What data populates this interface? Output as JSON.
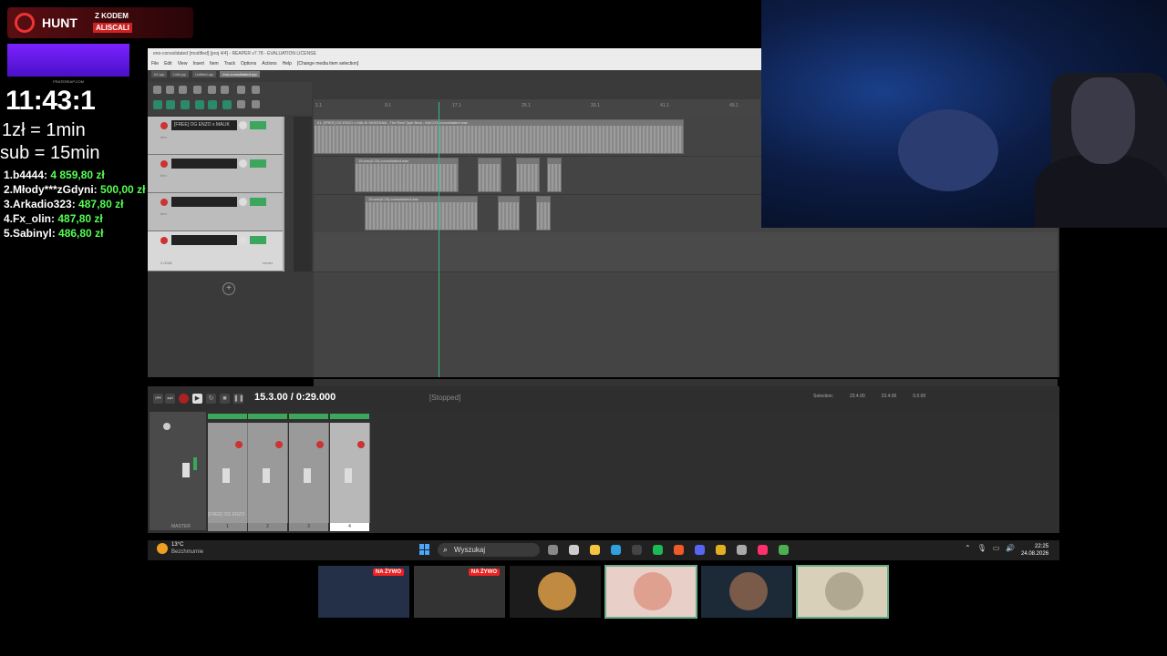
{
  "overlay": {
    "promo_brand": "HUNT",
    "promo_line1": "Z KODEM",
    "promo_code": "ALISCALI",
    "purple_caption": "PRATEREAP.COM",
    "timer": "11:43:1",
    "timer_digits": "43",
    "rate_line1": "1zł = 1min",
    "rate_line2": "sub = 15min",
    "leaderboard": [
      {
        "rank_name": "1.b4444:",
        "amount": "4 859,80 zł"
      },
      {
        "rank_name": "2.Młody***zGdyni:",
        "amount": "500,00 zł"
      },
      {
        "rank_name": "3.Arkadio323:",
        "amount": "487,80 zł"
      },
      {
        "rank_name": "4.Fx_olin:",
        "amount": "487,80 zł"
      },
      {
        "rank_name": "5.Sabinyl:",
        "amount": "486,80 zł"
      }
    ]
  },
  "reaper": {
    "title": "eno-consolidated [modified] [proj 4/4] - REAPER v7.78 - EVALUATION LICENSE",
    "menu": [
      "File",
      "Edit",
      "View",
      "Insert",
      "Item",
      "Track",
      "Options",
      "Actions",
      "Help",
      "[Change media item selection]"
    ],
    "tabs": [
      "h2.rpp",
      "h4d.rpp",
      "Untitled.rpp",
      "eno-consolidated.rpp"
    ],
    "ruler_ticks": [
      "1.1",
      "9.1",
      "17.1",
      "25.1",
      "33.1",
      "41.1",
      "49.1"
    ],
    "tracks": [
      {
        "name": "[FREE] OG ENZO x MALIK",
        "sub": "trim"
      },
      {
        "name": "",
        "sub": "trim"
      },
      {
        "name": "",
        "sub": "trim"
      },
      {
        "name": "",
        "sub": "0.00dB",
        "extra": "center"
      }
    ],
    "clips": [
      {
        "label": "01. [FREE] OG ENZO x MALIK MONTANA - The Real Type Beat - MACOS-consolidated.wav",
        "seg": "OFFLINE"
      },
      {
        "label": "15.wav(0.25)-consolidated.wav",
        "seg": "OFFLINE"
      },
      {
        "label": "15.wav(0.25)-consolidated.wav",
        "seg": "OFFLINE"
      }
    ],
    "transport_time": "15.3.00 / 0:29.000",
    "transport_state": "[Stopped]",
    "selection": [
      "Selection:",
      "23.4.00",
      "23.4.00",
      "0.0.00"
    ],
    "mixer_track_name": "[FREE] OG ENZO",
    "master_label": "MASTER",
    "mixer_nums": [
      "1",
      "2",
      "3",
      "4"
    ]
  },
  "taskbar": {
    "weather_temp": "13°C",
    "weather_cond": "Bezchmurnie",
    "search_placeholder": "Wyszukaj",
    "time": "22:25",
    "date": "24.08.2026",
    "icons": [
      {
        "name": "task-view-icon",
        "color": "#888888"
      },
      {
        "name": "store-icon",
        "color": "#cccccc"
      },
      {
        "name": "folder-icon",
        "color": "#f5c542"
      },
      {
        "name": "edge-icon",
        "color": "#2fa0e0"
      },
      {
        "name": "xbox-icon",
        "color": "#444444"
      },
      {
        "name": "spotify-icon",
        "color": "#1db954"
      },
      {
        "name": "brave-icon",
        "color": "#f05a28"
      },
      {
        "name": "discord-icon",
        "color": "#5865f2"
      },
      {
        "name": "chrome-icon",
        "color": "#e0b020"
      },
      {
        "name": "settings-icon",
        "color": "#aaaaaa"
      },
      {
        "name": "tiktok-icon",
        "color": "#ff2f6d"
      },
      {
        "name": "vpn-icon",
        "color": "#4caf50"
      }
    ]
  },
  "thumbnails": [
    {
      "name": "thumb-screen-1",
      "badge": "NA ŻYWO",
      "bg": "#243048"
    },
    {
      "name": "thumb-screen-2",
      "badge": "NA ŻYWO",
      "bg": "#333333"
    },
    {
      "name": "thumb-avatar-1",
      "badge": "",
      "bg": "#1c1c1c",
      "avatar": "#c08a40"
    },
    {
      "name": "thumb-avatar-2",
      "badge": "",
      "bg": "#e8d0c8",
      "avatar": "#e0a090"
    },
    {
      "name": "thumb-avatar-3",
      "badge": "",
      "bg": "#1c2a38",
      "avatar": "#7a5a48"
    },
    {
      "name": "thumb-avatar-4",
      "badge": "",
      "bg": "#d8d0b8",
      "avatar": "#b0a890"
    }
  ]
}
